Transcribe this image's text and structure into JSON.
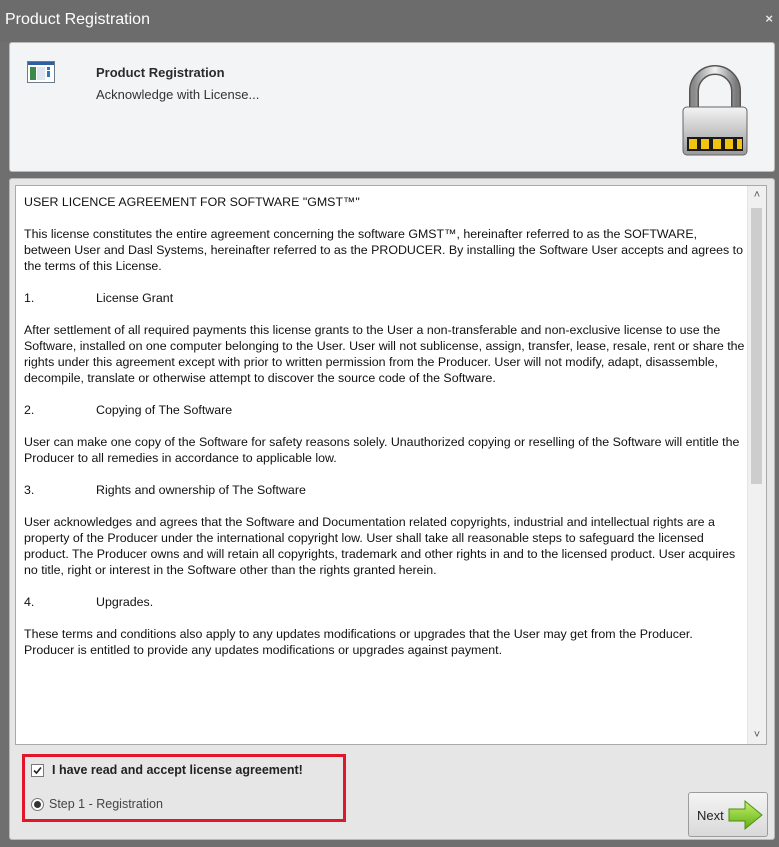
{
  "window": {
    "title": "Product Registration",
    "close_glyph": "×"
  },
  "header": {
    "title": "Product Registration",
    "subtitle": "Acknowledge with License...",
    "app_icon": "app-window-icon",
    "lock_icon": "padlock-icon"
  },
  "license": {
    "heading": "USER LICENCE AGREEMENT FOR SOFTWARE \"GMST™\"",
    "intro": "This license constitutes the entire agreement concerning the software GMST™, hereinafter referred to as the SOFTWARE, between User and Dasl Systems, hereinafter referred to as the PRODUCER. By installing the Software User accepts and agrees to the terms of this License.",
    "sections": [
      {
        "num": "1.",
        "title": "License Grant",
        "text": "After settlement of all required payments this license grants to the User a non-transferable and non-exclusive license to use the Software, installed on one computer belonging to the User. User will not sublicense, assign, transfer, lease, resale, rent or share the rights under this agreement except with prior to written permission from the Producer. User will not modify, adapt, disassemble, decompile, translate or otherwise attempt to discover the source code of the Software."
      },
      {
        "num": "2.",
        "title": "Copying of The Software",
        "text": "User can make one copy of the Software for safety reasons solely. Unauthorized copying or reselling of the Software will entitle the Producer to all remedies in accordance to applicable low."
      },
      {
        "num": "3.",
        "title": "Rights and ownership of The Software",
        "text": "User acknowledges and agrees that the Software and Documentation related copyrights, industrial and intellectual rights are a property of the Producer under the international copyright low. User shall take all reasonable steps to safeguard the licensed product. The Producer owns and will retain all copyrights, trademark and other rights in and to the licensed product.  User acquires no title, right or interest in the Software other than the rights granted herein."
      },
      {
        "num": "4.",
        "title": " Upgrades.",
        "text": "These terms and conditions also apply to any updates modifications or upgrades that the User may get from the Producer. Producer is entitled to provide any updates modifications or upgrades against payment."
      }
    ],
    "scroll_up_glyph": "˄",
    "scroll_down_glyph": "˅"
  },
  "accept": {
    "label": "I have read and accept license agreement!",
    "checked": true
  },
  "steps": {
    "current_label": "Step 1 - Registration",
    "selected": true
  },
  "buttons": {
    "next_label": "Next"
  },
  "colors": {
    "highlight": "#e0162b",
    "arrow": "#8fd11f"
  }
}
